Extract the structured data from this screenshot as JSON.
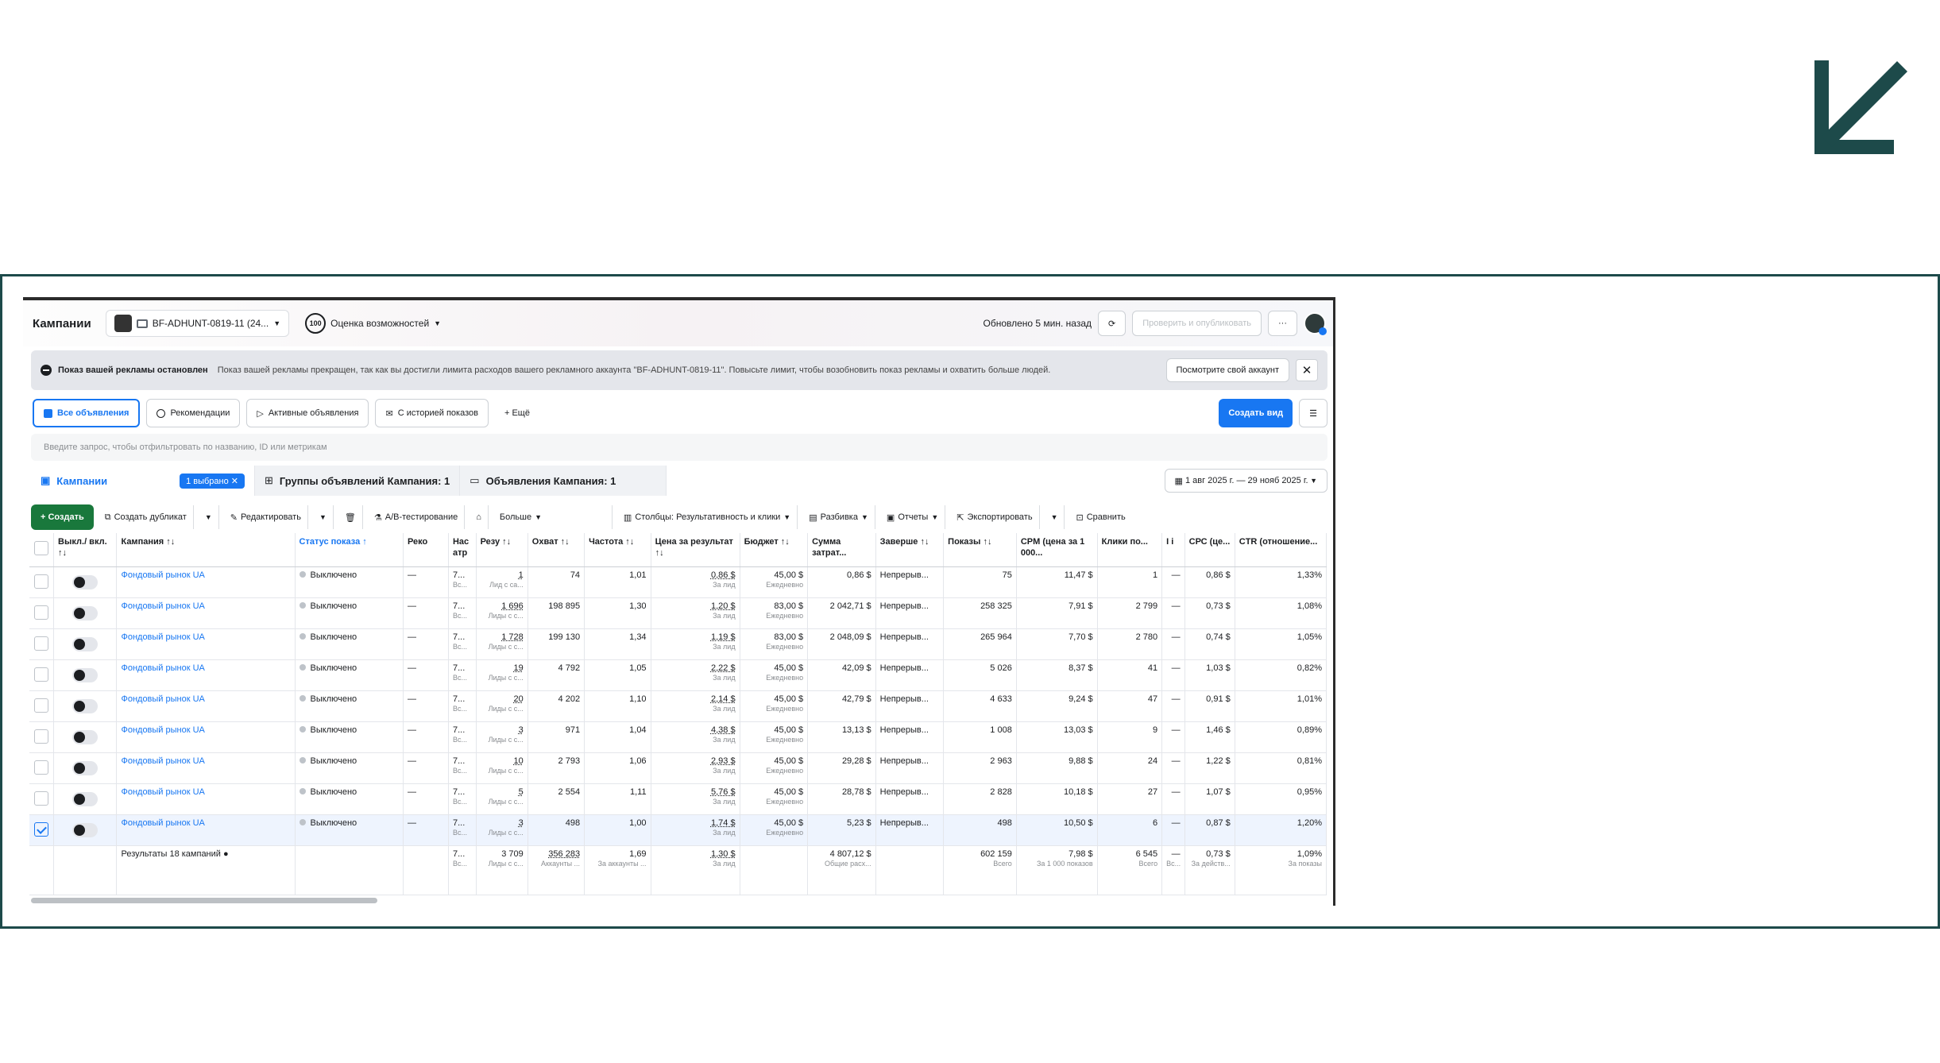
{
  "header": {
    "title": "Кампании",
    "account": "BF-ADHUNT-0819-11 (24...",
    "score_badge": "100",
    "score_label": "Оценка возможностей",
    "updated": "Обновлено 5 мин. назад",
    "publish": "Проверить и опубликовать",
    "more": "···"
  },
  "alert": {
    "title": "Показ вашей рекламы остановлен",
    "message": "Показ вашей рекламы прекращен, так как вы достигли лимита расходов вашего рекламного аккаунта \"BF-ADHUNT-0819-11\". Повысьте лимит, чтобы возобновить показ рекламы и охватить больше людей.",
    "button": "Посмотрите свой аккаунт",
    "close": "✕"
  },
  "tabs": {
    "all": "Все объявления",
    "recs": "Рекомендации",
    "active": "Активные объявления",
    "history": "С историей показов",
    "more": "+ Ещё",
    "create_view": "Создать вид"
  },
  "search": {
    "placeholder": "Введите запрос, чтобы отфильтровать по названию, ID или метрикам"
  },
  "subtabs": {
    "campaigns": "Кампании",
    "selected": "1 выбрано ✕",
    "adsets": "Группы объявлений Кампания: 1",
    "ads": "Объявления Кампания: 1",
    "date": "1 авг 2025 г. — 29 нояб 2025 г."
  },
  "toolbar": {
    "create": "+ Создать",
    "duplicate": "Создать дубликат",
    "edit": "Редактировать",
    "ab": "A/B-тестирование",
    "more": "Больше",
    "columns": "Столбцы: Результативность и клики",
    "breakdown": "Разбивка",
    "reports": "Отчеты",
    "export": "Экспортировать",
    "compare": "Сравнить"
  },
  "columns": [
    "",
    "Выкл./ вкл. ↑↓",
    "Кампания ↑↓",
    "Статус показа ↑",
    "Реко",
    "Нас атр",
    "Резу ↑↓",
    "Охват ↑↓",
    "Частота ↑↓",
    "Цена за результат ↑↓",
    "Бюджет ↑↓",
    "Сумма затрат...",
    "Заверше ↑↓",
    "Показы ↑↓",
    "CPM (цена за 1 000...",
    "Клики по...",
    "I i",
    "СРС (це...",
    "CTR (отношение..."
  ],
  "rows": [
    {
      "name": "Фондовый рынок UA",
      "status": "Выключено",
      "reco": "—",
      "attr": "7...",
      "attr_sub": "Вс...",
      "res": "1",
      "res_sub": "Лид с са...",
      "reach": "74",
      "freq": "1,01",
      "cpr": "0,86 $",
      "cpr_sub": "За лид",
      "budget": "45,00 $",
      "budget_sub": "Ежедневно",
      "spent": "0,86 $",
      "end": "Непрерыв...",
      "impr": "75",
      "cpm": "11,47 $",
      "clicks": "1",
      "i": "—",
      "cpc": "0,86 $",
      "ctr": "1,33%",
      "checked": false
    },
    {
      "name": "Фондовый рынок UA",
      "status": "Выключено",
      "reco": "—",
      "attr": "7...",
      "attr_sub": "Вс...",
      "res": "1 696",
      "res_sub": "Лиды с с...",
      "reach": "198 895",
      "freq": "1,30",
      "cpr": "1,20 $",
      "cpr_sub": "За лид",
      "budget": "83,00 $",
      "budget_sub": "Ежедневно",
      "spent": "2 042,71 $",
      "end": "Непрерыв...",
      "impr": "258 325",
      "cpm": "7,91 $",
      "clicks": "2 799",
      "i": "—",
      "cpc": "0,73 $",
      "ctr": "1,08%",
      "checked": false
    },
    {
      "name": "Фондовый рынок UA",
      "status": "Выключено",
      "reco": "—",
      "attr": "7...",
      "attr_sub": "Вс...",
      "res": "1 728",
      "res_sub": "Лиды с с...",
      "reach": "199 130",
      "freq": "1,34",
      "cpr": "1,19 $",
      "cpr_sub": "За лид",
      "budget": "83,00 $",
      "budget_sub": "Ежедневно",
      "spent": "2 048,09 $",
      "end": "Непрерыв...",
      "impr": "265 964",
      "cpm": "7,70 $",
      "clicks": "2 780",
      "i": "—",
      "cpc": "0,74 $",
      "ctr": "1,05%",
      "checked": false
    },
    {
      "name": "Фондовый рынок UA",
      "status": "Выключено",
      "reco": "—",
      "attr": "7...",
      "attr_sub": "Вс...",
      "res": "19",
      "res_sub": "Лиды с с...",
      "reach": "4 792",
      "freq": "1,05",
      "cpr": "2,22 $",
      "cpr_sub": "За лид",
      "budget": "45,00 $",
      "budget_sub": "Ежедневно",
      "spent": "42,09 $",
      "end": "Непрерыв...",
      "impr": "5 026",
      "cpm": "8,37 $",
      "clicks": "41",
      "i": "—",
      "cpc": "1,03 $",
      "ctr": "0,82%",
      "checked": false
    },
    {
      "name": "Фондовый рынок UA",
      "status": "Выключено",
      "reco": "—",
      "attr": "7...",
      "attr_sub": "Вс...",
      "res": "20",
      "res_sub": "Лиды с с...",
      "reach": "4 202",
      "freq": "1,10",
      "cpr": "2,14 $",
      "cpr_sub": "За лид",
      "budget": "45,00 $",
      "budget_sub": "Ежедневно",
      "spent": "42,79 $",
      "end": "Непрерыв...",
      "impr": "4 633",
      "cpm": "9,24 $",
      "clicks": "47",
      "i": "—",
      "cpc": "0,91 $",
      "ctr": "1,01%",
      "checked": false
    },
    {
      "name": "Фондовый рынок UA",
      "status": "Выключено",
      "reco": "—",
      "attr": "7...",
      "attr_sub": "Вс...",
      "res": "3",
      "res_sub": "Лиды с с...",
      "reach": "971",
      "freq": "1,04",
      "cpr": "4,38 $",
      "cpr_sub": "За лид",
      "budget": "45,00 $",
      "budget_sub": "Ежедневно",
      "spent": "13,13 $",
      "end": "Непрерыв...",
      "impr": "1 008",
      "cpm": "13,03 $",
      "clicks": "9",
      "i": "—",
      "cpc": "1,46 $",
      "ctr": "0,89%",
      "checked": false
    },
    {
      "name": "Фондовый рынок UA",
      "status": "Выключено",
      "reco": "—",
      "attr": "7...",
      "attr_sub": "Вс...",
      "res": "10",
      "res_sub": "Лиды с с...",
      "reach": "2 793",
      "freq": "1,06",
      "cpr": "2,93 $",
      "cpr_sub": "За лид",
      "budget": "45,00 $",
      "budget_sub": "Ежедневно",
      "spent": "29,28 $",
      "end": "Непрерыв...",
      "impr": "2 963",
      "cpm": "9,88 $",
      "clicks": "24",
      "i": "—",
      "cpc": "1,22 $",
      "ctr": "0,81%",
      "checked": false
    },
    {
      "name": "Фондовый рынок UA",
      "status": "Выключено",
      "reco": "—",
      "attr": "7...",
      "attr_sub": "Вс...",
      "res": "5",
      "res_sub": "Лиды с с...",
      "reach": "2 554",
      "freq": "1,11",
      "cpr": "5,76 $",
      "cpr_sub": "За лид",
      "budget": "45,00 $",
      "budget_sub": "Ежедневно",
      "spent": "28,78 $",
      "end": "Непрерыв...",
      "impr": "2 828",
      "cpm": "10,18 $",
      "clicks": "27",
      "i": "—",
      "cpc": "1,07 $",
      "ctr": "0,95%",
      "checked": false
    },
    {
      "name": "Фондовый рынок UA",
      "status": "Выключено",
      "reco": "—",
      "attr": "7...",
      "attr_sub": "Вс...",
      "res": "3",
      "res_sub": "Лиды с с...",
      "reach": "498",
      "freq": "1,00",
      "cpr": "1,74 $",
      "cpr_sub": "За лид",
      "budget": "45,00 $",
      "budget_sub": "Ежедневно",
      "spent": "5,23 $",
      "end": "Непрерыв...",
      "impr": "498",
      "cpm": "10,50 $",
      "clicks": "6",
      "i": "—",
      "cpc": "0,87 $",
      "ctr": "1,20%",
      "checked": true
    }
  ],
  "totals": {
    "label": "Результаты 18 кампаний",
    "attr": "7...",
    "attr_sub": "Вс...",
    "res": "3 709",
    "res_sub": "Лиды с с...",
    "reach": "356 283",
    "reach_sub": "Аккаунты ...",
    "freq": "1,69",
    "freq_sub": "За аккаунты ...",
    "cpr": "1,30 $",
    "cpr_sub": "За лид",
    "spent": "4 807,12 $",
    "spent_sub": "Общие расх...",
    "impr": "602 159",
    "impr_sub": "Всего",
    "cpm": "7,98 $",
    "cpm_sub": "За 1 000 показов",
    "clicks": "6 545",
    "clicks_sub": "Всего",
    "i": "—",
    "i_sub": "Вс...",
    "cpc": "0,73 $",
    "cpc_sub": "За действ...",
    "ctr": "1,09%",
    "ctr_sub": "За показы"
  }
}
